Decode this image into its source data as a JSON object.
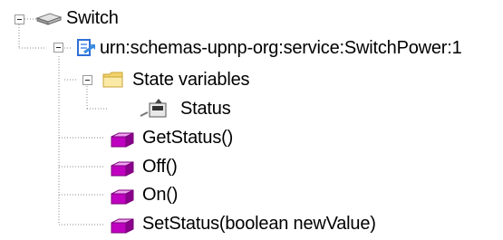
{
  "tree": {
    "device": {
      "label": "Switch",
      "icon": "router-device-icon"
    },
    "service": {
      "label": "urn:schemas-upnp-org:service:SwitchPower:1",
      "icon": "service-icon"
    },
    "state_folder": {
      "label": "State variables",
      "icon": "folder-icon"
    },
    "state_var": {
      "label": "Status",
      "icon": "state-variable-icon"
    },
    "actions": [
      {
        "label": "GetStatus()",
        "icon": "action-cube-icon"
      },
      {
        "label": "Off()",
        "icon": "action-cube-icon"
      },
      {
        "label": "On()",
        "icon": "action-cube-icon"
      },
      {
        "label": "SetStatus(boolean newValue)",
        "icon": "action-cube-icon"
      }
    ]
  },
  "colors": {
    "action_cube": "#c000c0",
    "folder": "#f2d36b",
    "service": "#2f6fd6",
    "lines": "#9a9a9a"
  }
}
